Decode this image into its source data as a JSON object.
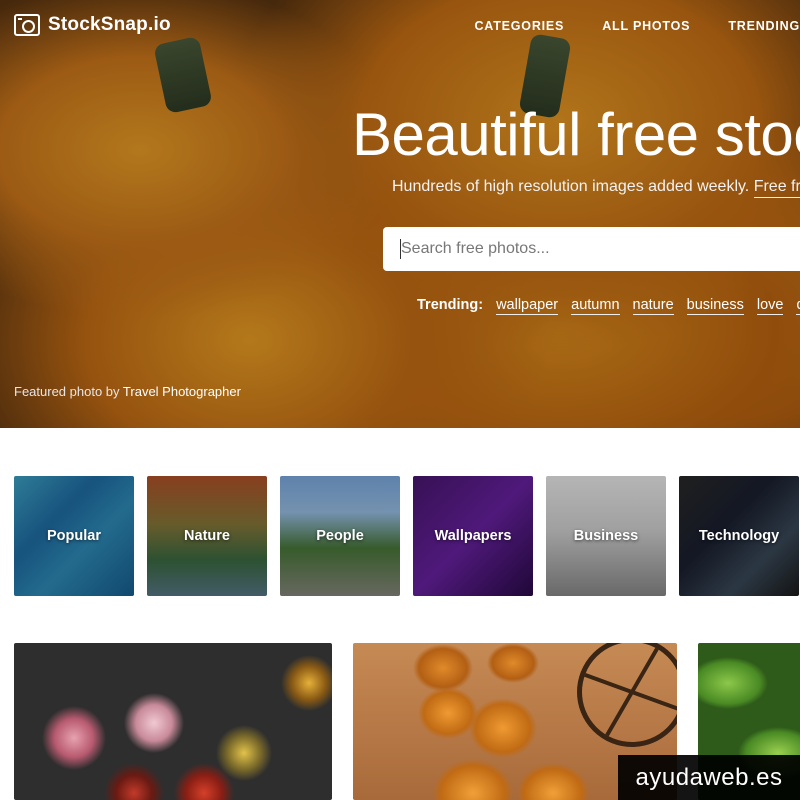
{
  "header": {
    "logo_text": "StockSnap.io",
    "nav": [
      "CATEGORIES",
      "ALL PHOTOS",
      "TRENDING"
    ]
  },
  "hero": {
    "title": "Beautiful free stoc",
    "subtitle": "Hundreds of high resolution images added weekly.",
    "subtitle_link": "Free fro",
    "search_placeholder": "Search free photos...",
    "trending_label": "Trending:",
    "trending_tags": [
      "wallpaper",
      "autumn",
      "nature",
      "business",
      "love",
      "des"
    ],
    "featured_prefix": "Featured photo by",
    "featured_author": "Travel Photographer"
  },
  "categories": [
    "Popular",
    "Nature",
    "People",
    "Wallpapers",
    "Business",
    "Technology"
  ],
  "watermark": "ayudaweb.es"
}
